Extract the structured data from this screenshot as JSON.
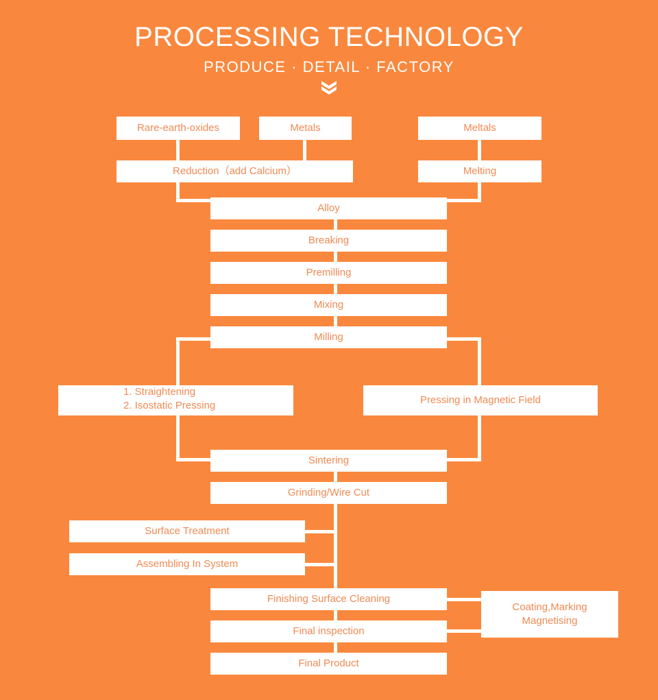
{
  "header": {
    "title": "PROCESSING TECHNOLOGY",
    "subtitle": "PRODUCE · DETAIL · FACTORY",
    "chevron_icon": "chevron-double-down-icon"
  },
  "colors": {
    "background": "#F9883E",
    "box_fill": "#FFFFFF",
    "box_text": "#F08A53",
    "header_text": "#FFFFFF",
    "connector": "#FFFDF8"
  },
  "chart_data": {
    "type": "diagram",
    "title": "PROCESSING TECHNOLOGY",
    "subtitle": "PRODUCE · DETAIL · FACTORY",
    "orientation": "top-to-bottom",
    "nodes": [
      {
        "id": "rare-earth-oxides",
        "label": "Rare-earth-oxides"
      },
      {
        "id": "metals",
        "label": "Metals"
      },
      {
        "id": "meltals",
        "label": "Meltals"
      },
      {
        "id": "reduction",
        "label": "Reduction（add Calcium）"
      },
      {
        "id": "melting",
        "label": "Melting"
      },
      {
        "id": "alloy",
        "label": "Alloy"
      },
      {
        "id": "breaking",
        "label": "Breaking"
      },
      {
        "id": "premilling",
        "label": "Premilling"
      },
      {
        "id": "mixing",
        "label": "Mixing"
      },
      {
        "id": "milling",
        "label": "Milling"
      },
      {
        "id": "straightening",
        "label": "1. Straightening\n2. Isostatic Pressing"
      },
      {
        "id": "pressing-magnetic-field",
        "label": "Pressing in Magnetic Field"
      },
      {
        "id": "sintering",
        "label": "Sintering"
      },
      {
        "id": "grinding-wire-cut",
        "label": "Grinding/Wire Cut"
      },
      {
        "id": "surface-treatment",
        "label": "Surface Treatment"
      },
      {
        "id": "assembling-in-system",
        "label": "Assembling In System"
      },
      {
        "id": "finishing-surface-cleaning",
        "label": "Finishing Surface Cleaning"
      },
      {
        "id": "final-inspection",
        "label": "Final inspection"
      },
      {
        "id": "final-product",
        "label": "Final Product"
      },
      {
        "id": "coating-marking-magnetising",
        "label": "Coating,Marking\nMagnetising"
      }
    ],
    "edges": [
      [
        "rare-earth-oxides",
        "reduction"
      ],
      [
        "metals",
        "reduction"
      ],
      [
        "meltals",
        "melting"
      ],
      [
        "reduction",
        "alloy"
      ],
      [
        "melting",
        "alloy"
      ],
      [
        "alloy",
        "breaking"
      ],
      [
        "breaking",
        "premilling"
      ],
      [
        "premilling",
        "mixing"
      ],
      [
        "mixing",
        "milling"
      ],
      [
        "milling",
        "straightening"
      ],
      [
        "milling",
        "pressing-magnetic-field"
      ],
      [
        "straightening",
        "sintering"
      ],
      [
        "pressing-magnetic-field",
        "sintering"
      ],
      [
        "sintering",
        "grinding-wire-cut"
      ],
      [
        "grinding-wire-cut",
        "surface-treatment"
      ],
      [
        "grinding-wire-cut",
        "assembling-in-system"
      ],
      [
        "grinding-wire-cut",
        "finishing-surface-cleaning"
      ],
      [
        "finishing-surface-cleaning",
        "coating-marking-magnetising"
      ],
      [
        "finishing-surface-cleaning",
        "final-inspection"
      ],
      [
        "final-inspection",
        "coating-marking-magnetising"
      ],
      [
        "final-inspection",
        "final-product"
      ]
    ]
  },
  "nodes": {
    "rare_earth_oxides": "Rare-earth-oxides",
    "metals": "Metals",
    "meltals": "Meltals",
    "reduction": "Reduction（add Calcium）",
    "melting": "Melting",
    "alloy": "Alloy",
    "breaking": "Breaking",
    "premilling": "Premilling",
    "mixing": "Mixing",
    "milling": "Milling",
    "straightening_line1": "1. Straightening",
    "straightening_line2": "2. Isostatic Pressing",
    "pressing_magnetic_field": "Pressing in Magnetic Field",
    "sintering": "Sintering",
    "grinding_wire_cut": "Grinding/Wire Cut",
    "surface_treatment": "Surface Treatment",
    "assembling_in_system": "Assembling In System",
    "finishing_surface_cleaning": "Finishing Surface Cleaning",
    "final_inspection": "Final inspection",
    "final_product": "Final Product",
    "coating_line1": "Coating,Marking",
    "coating_line2": "Magnetising"
  }
}
